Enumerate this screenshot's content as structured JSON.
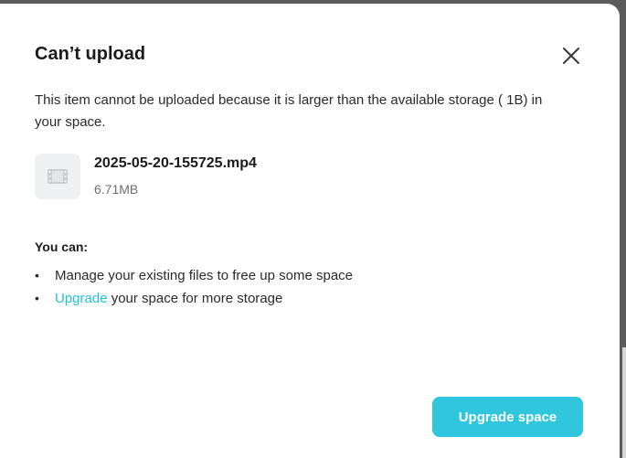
{
  "dialog": {
    "title": "Can’t upload",
    "message": "This item cannot be uploaded because it is larger than the available storage ( 1B) in your space."
  },
  "file": {
    "name": "2025-05-20-155725.mp4",
    "size": "6.71MB",
    "icon": "video-file-icon"
  },
  "options": {
    "heading": "You can:",
    "bullet": "•",
    "item1": "Manage your existing files to free up some space",
    "item2_link": "Upgrade",
    "item2_rest": " your space for more storage"
  },
  "actions": {
    "upgrade_label": "Upgrade space"
  },
  "colors": {
    "accent": "#2fc6de",
    "link": "#23bfd8",
    "overlay": "#5b5b5b"
  }
}
